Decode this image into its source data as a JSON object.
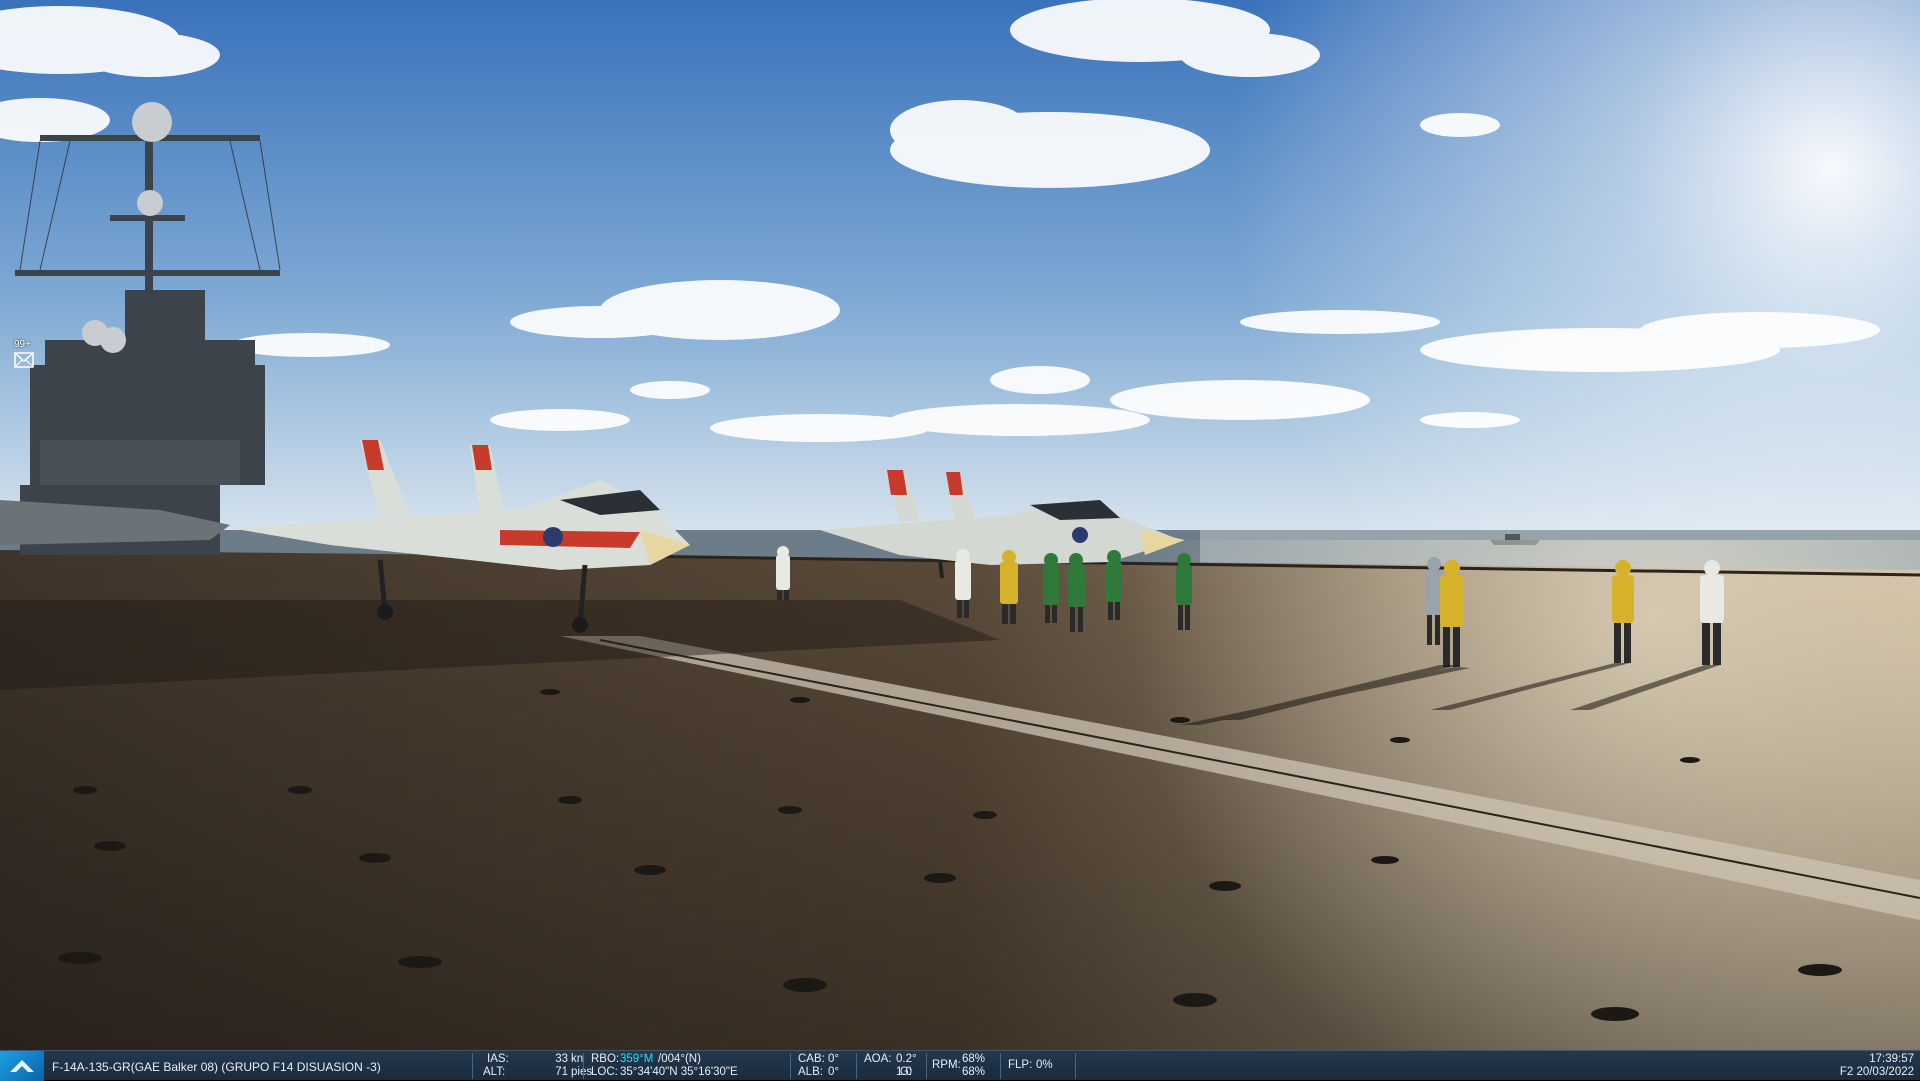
{
  "mail": {
    "count": "99+"
  },
  "statusbar": {
    "unit": "F-14A-135-GR(GAE  Balker 08) (GRUPO F14 DISUASION -3)",
    "ias_label": "IAS:",
    "ias_value": "33",
    "ias_unit": "kn",
    "alt_label": "ALT:",
    "alt_value": "71",
    "alt_unit": "pies",
    "rbo_label": "RBO:",
    "rbo_mag": "359°M",
    "rbo_true": "/004°(N)",
    "loc_label": "LOC:",
    "loc_value": "35°34'40\"N 35°16'30\"E",
    "cab_label": "CAB:",
    "cab_value": "0°",
    "alb_label": "ALB:",
    "alb_value": "0°",
    "aoa_label": "AOA:",
    "aoa_value": "0.2°",
    "g_label": "G:",
    "g_value": "1.0",
    "rpm_label": "RPM:",
    "rpm_1": "68%",
    "rpm_2": "68%",
    "flp_label": "FLP:",
    "flp_value": "0%",
    "time": "17:39:57",
    "date": "F2 20/03/2022"
  },
  "colors": {
    "sky_top": "#3f78c0",
    "sky_horizon": "#d7e4ee",
    "deck": "#5a4c3c",
    "sea": "#6f7e8a",
    "statusbar": "#1f3245",
    "highlight": "#35d6ff"
  }
}
